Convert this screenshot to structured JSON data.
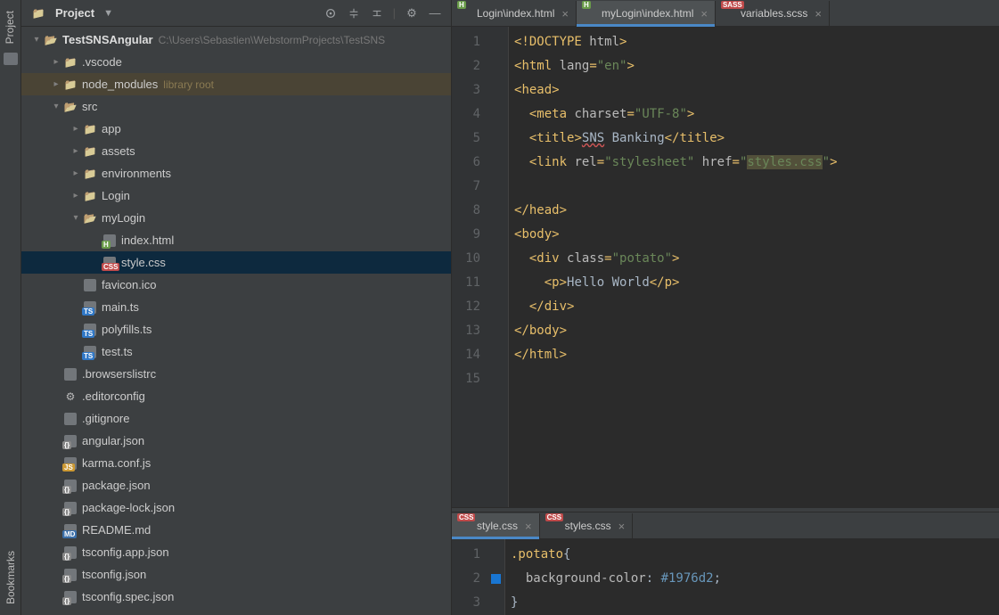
{
  "left_gutter": {
    "top_label": "Project",
    "bottom_label": "Bookmarks"
  },
  "panel": {
    "title": "Project",
    "tree": [
      {
        "d": 0,
        "a": "open",
        "icon": "folder-open",
        "name": "TestSNSAngular",
        "bold": true,
        "path": "C:\\Users\\Sebastien\\WebstormProjects\\TestSNS"
      },
      {
        "d": 1,
        "a": "closed",
        "icon": "folder",
        "name": ".vscode"
      },
      {
        "d": 1,
        "a": "closed",
        "icon": "folder",
        "name": "node_modules",
        "lib": "library root",
        "hl": true
      },
      {
        "d": 1,
        "a": "open",
        "icon": "folder-open",
        "name": "src"
      },
      {
        "d": 2,
        "a": "closed",
        "icon": "folder",
        "name": "app"
      },
      {
        "d": 2,
        "a": "closed",
        "icon": "folder",
        "name": "assets"
      },
      {
        "d": 2,
        "a": "closed",
        "icon": "folder",
        "name": "environments"
      },
      {
        "d": 2,
        "a": "closed",
        "icon": "folder",
        "name": "Login"
      },
      {
        "d": 2,
        "a": "open",
        "icon": "folder-open",
        "name": "myLogin"
      },
      {
        "d": 3,
        "a": "none",
        "icon": "html",
        "name": "index.html"
      },
      {
        "d": 3,
        "a": "none",
        "icon": "css",
        "name": "style.css",
        "sel": true
      },
      {
        "d": 2,
        "a": "none",
        "icon": "generic",
        "name": "favicon.ico"
      },
      {
        "d": 2,
        "a": "none",
        "icon": "ts",
        "name": "main.ts"
      },
      {
        "d": 2,
        "a": "none",
        "icon": "ts",
        "name": "polyfills.ts"
      },
      {
        "d": 2,
        "a": "none",
        "icon": "ts",
        "name": "test.ts"
      },
      {
        "d": 1,
        "a": "none",
        "icon": "generic",
        "name": ".browserslistrc"
      },
      {
        "d": 1,
        "a": "none",
        "icon": "gear",
        "name": ".editorconfig"
      },
      {
        "d": 1,
        "a": "none",
        "icon": "generic",
        "name": ".gitignore"
      },
      {
        "d": 1,
        "a": "none",
        "icon": "json",
        "name": "angular.json"
      },
      {
        "d": 1,
        "a": "none",
        "icon": "js",
        "name": "karma.conf.js"
      },
      {
        "d": 1,
        "a": "none",
        "icon": "json",
        "name": "package.json"
      },
      {
        "d": 1,
        "a": "none",
        "icon": "json",
        "name": "package-lock.json"
      },
      {
        "d": 1,
        "a": "none",
        "icon": "md",
        "name": "README.md"
      },
      {
        "d": 1,
        "a": "none",
        "icon": "json",
        "name": "tsconfig.app.json"
      },
      {
        "d": 1,
        "a": "none",
        "icon": "json",
        "name": "tsconfig.json"
      },
      {
        "d": 1,
        "a": "none",
        "icon": "json",
        "name": "tsconfig.spec.json"
      }
    ]
  },
  "top_tabs": [
    {
      "icon": "html",
      "label": "Login\\index.html"
    },
    {
      "icon": "html",
      "label": "myLogin\\index.html",
      "active": true
    },
    {
      "icon": "sass",
      "label": "variables.scss"
    }
  ],
  "top_code": {
    "lines": [
      "1",
      "2",
      "3",
      "4",
      "5",
      "6",
      "7",
      "8",
      "9",
      "10",
      "11",
      "12",
      "13",
      "14",
      "15"
    ],
    "rows": [
      {
        "html": "<span class='kw-punc'>&lt;!</span><span class='kw-tag'>DOCTYPE </span><span class='kw-attr'>html</span><span class='kw-punc'>&gt;</span>"
      },
      {
        "html": "<span class='kw-punc'>&lt;</span><span class='kw-tag'>html </span><span class='kw-attr'>lang</span><span class='kw-punc'>=</span><span class='kw-str'>\"en\"</span><span class='kw-punc'>&gt;</span>"
      },
      {
        "html": "<span class='kw-punc'>&lt;</span><span class='kw-tag'>head</span><span class='kw-punc'>&gt;</span>"
      },
      {
        "html": "  <span class='kw-punc'>&lt;</span><span class='kw-tag'>meta </span><span class='kw-attr'>charset</span><span class='kw-punc'>=</span><span class='kw-str'>\"UTF-8\"</span><span class='kw-punc'>&gt;</span>"
      },
      {
        "html": "  <span class='kw-punc'>&lt;</span><span class='kw-tag'>title</span><span class='kw-punc'>&gt;</span><span class='err-underline'>SNS</span> Banking<span class='kw-punc'>&lt;/</span><span class='kw-tag'>title</span><span class='kw-punc'>&gt;</span>"
      },
      {
        "html": "  <span class='kw-punc'>&lt;</span><span class='kw-tag'>link </span><span class='kw-attr'>rel</span><span class='kw-punc'>=</span><span class='kw-str'>\"stylesheet\"</span> <span class='kw-attr'>href</span><span class='kw-punc'>=</span><span class='kw-str'>\"<span class='hl-warn'>styles.css</span>\"</span><span class='kw-punc'>&gt;</span>"
      },
      {
        "html": ""
      },
      {
        "html": "<span class='kw-punc'>&lt;/</span><span class='kw-tag'>head</span><span class='kw-punc'>&gt;</span>"
      },
      {
        "html": "<span class='kw-punc'>&lt;</span><span class='kw-tag'>body</span><span class='kw-punc'>&gt;</span>"
      },
      {
        "html": "  <span class='kw-punc'>&lt;</span><span class='kw-tag'>div </span><span class='kw-attr'>class</span><span class='kw-punc'>=</span><span class='kw-str'>\"potato\"</span><span class='kw-punc'>&gt;</span>"
      },
      {
        "html": "    <span class='kw-punc'>&lt;</span><span class='kw-tag'>p</span><span class='kw-punc'>&gt;</span>Hello World<span class='kw-punc'>&lt;/</span><span class='kw-tag'>p</span><span class='kw-punc'>&gt;</span>"
      },
      {
        "html": "  <span class='kw-punc'>&lt;/</span><span class='kw-tag'>div</span><span class='kw-punc'>&gt;</span>"
      },
      {
        "html": "<span class='kw-punc'>&lt;/</span><span class='kw-tag'>body</span><span class='kw-punc'>&gt;</span>"
      },
      {
        "html": "<span class='kw-punc'>&lt;/</span><span class='kw-tag'>html</span><span class='kw-punc'>&gt;</span>"
      },
      {
        "html": ""
      }
    ]
  },
  "bottom_tabs": [
    {
      "icon": "css",
      "label": "style.css",
      "active": true
    },
    {
      "icon": "css",
      "label": "styles.css"
    }
  ],
  "bottom_code": {
    "lines": [
      "1",
      "2",
      "3"
    ],
    "rows": [
      {
        "html": "<span class='kw-sel'>.potato</span><span class='kw-brace'>{</span>"
      },
      {
        "html": "  <span class='kw-prop'>background-color</span>: <span class='kw-val'>#1976d2</span>;",
        "swatch": "#1976d2"
      },
      {
        "html": "<span class='kw-brace'>}</span>"
      }
    ]
  }
}
